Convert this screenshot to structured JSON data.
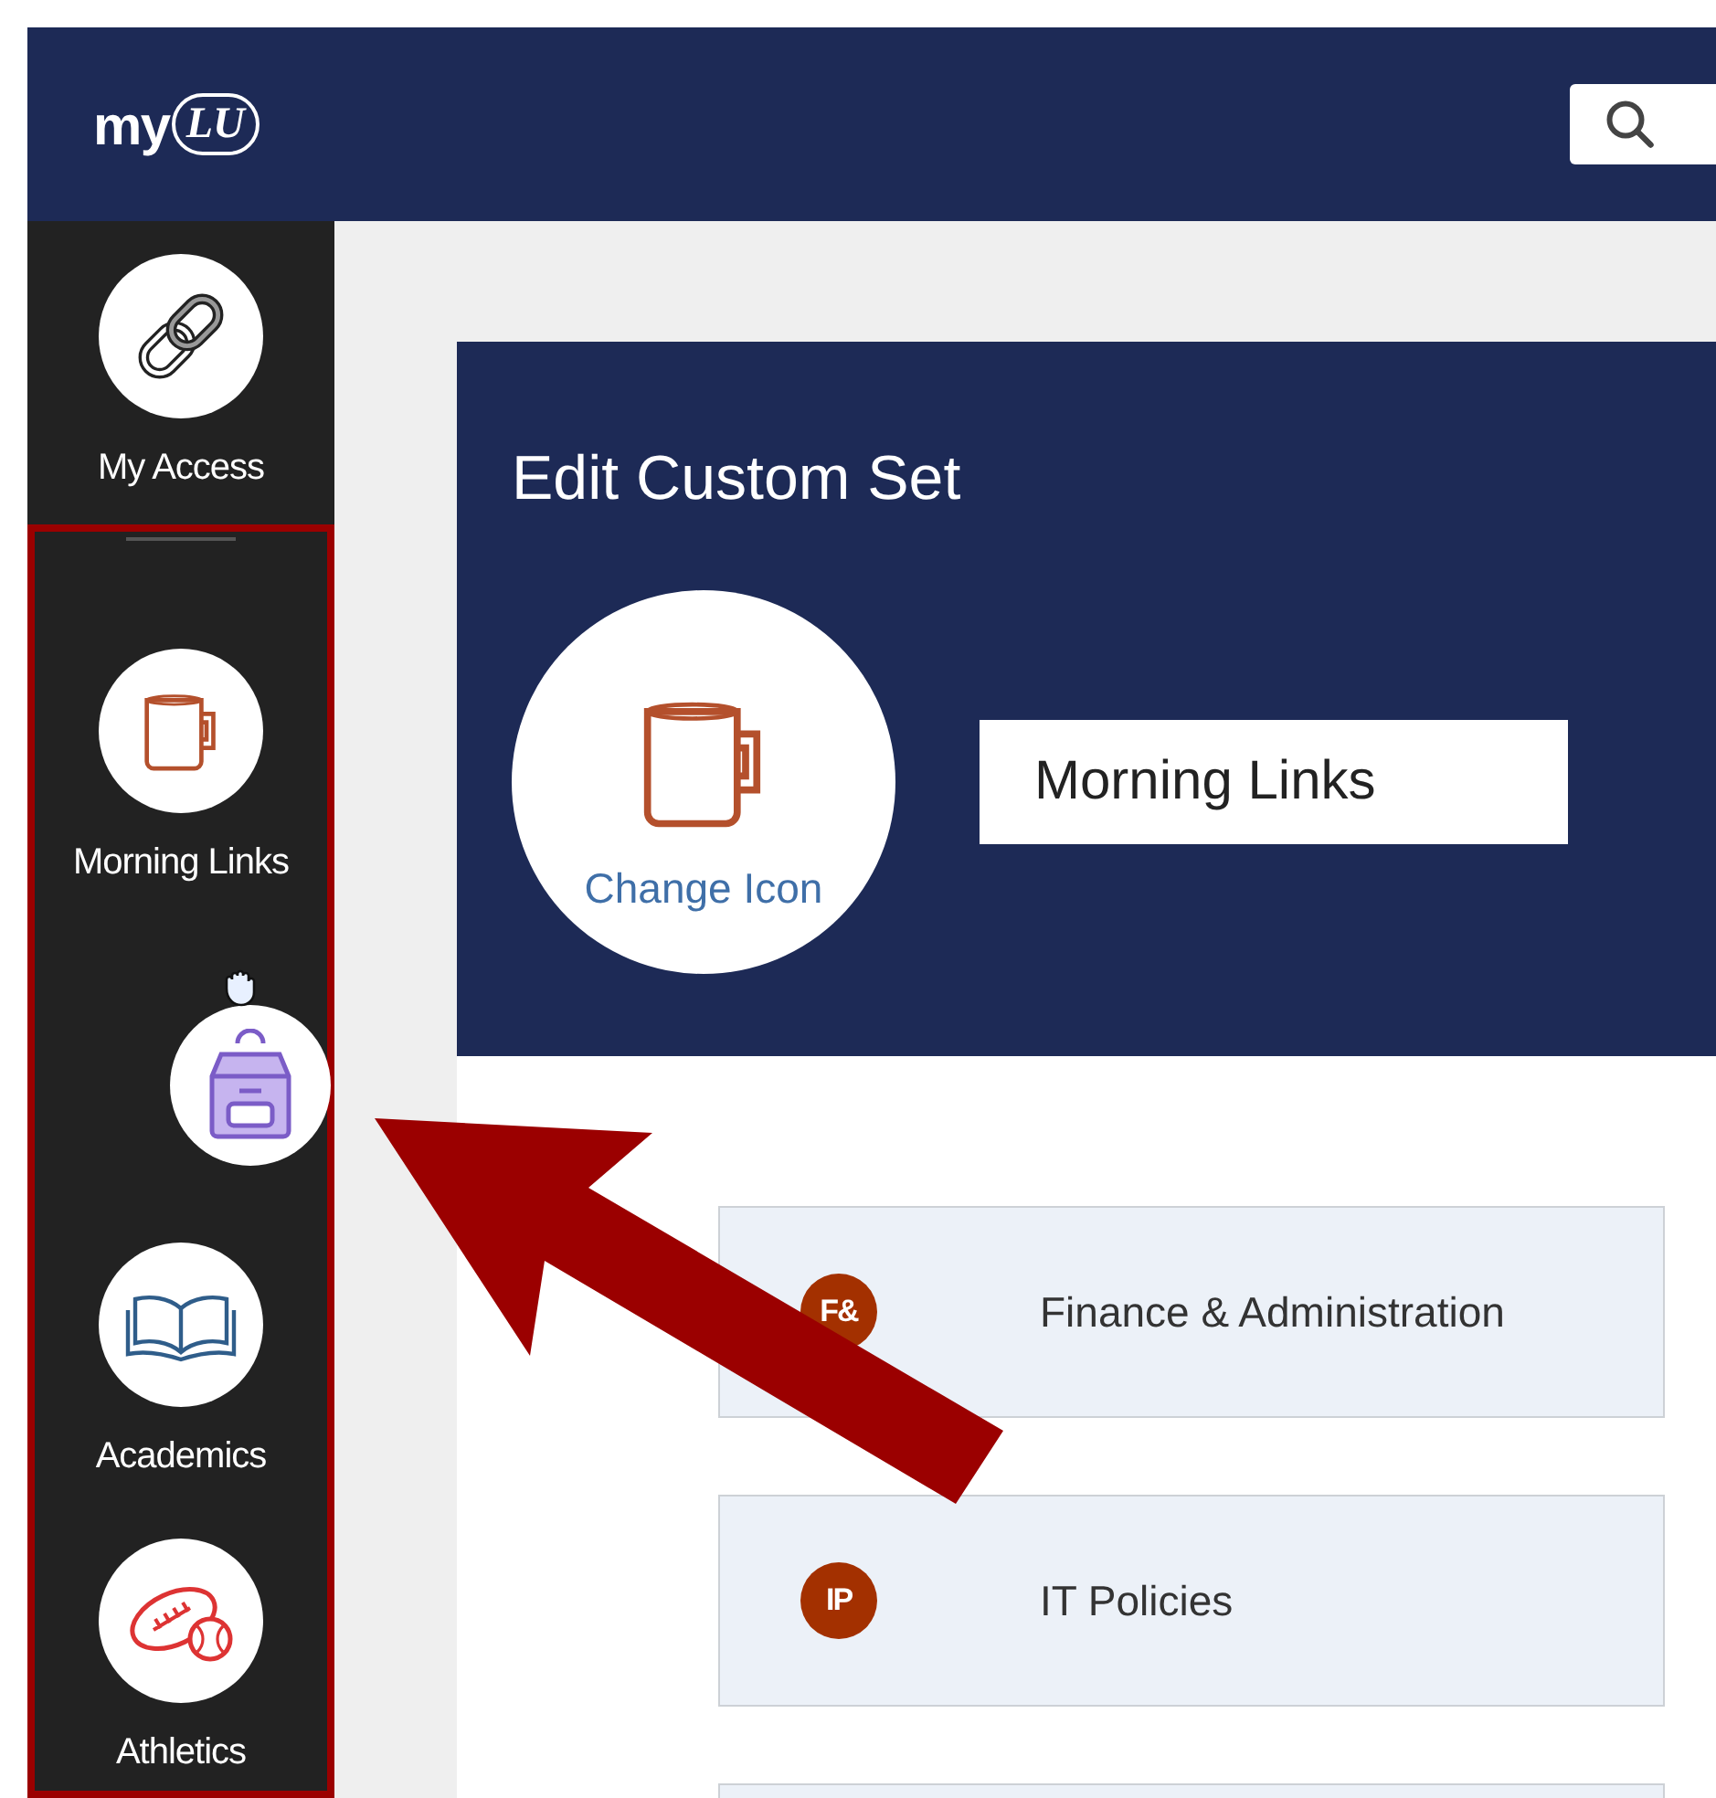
{
  "header": {
    "logo": {
      "text": "my",
      "mark": "LU"
    }
  },
  "sidebar": {
    "pinned": [
      {
        "kind": "link",
        "label": "My Access"
      }
    ],
    "custom_sets": [
      {
        "kind": "mug",
        "dragging": false,
        "label": "Morning Links"
      },
      {
        "kind": "backpack",
        "dragging": true
      },
      {
        "kind": "book",
        "dragging": false,
        "label": "Academics"
      },
      {
        "kind": "sports",
        "dragging": false,
        "label": "Athletics"
      }
    ]
  },
  "editor": {
    "title": "Edit Custom Set",
    "change_icon": "Change Icon",
    "name_value": "Morning Links"
  },
  "links": [
    {
      "kind": "item",
      "badge": "F&",
      "label": "Finance & Administration"
    },
    {
      "kind": "item",
      "badge": "IP",
      "label": "IT Policies"
    },
    {
      "kind": "cut_off"
    }
  ],
  "annotation": {
    "highlight_frame": true,
    "arrow": true
  }
}
